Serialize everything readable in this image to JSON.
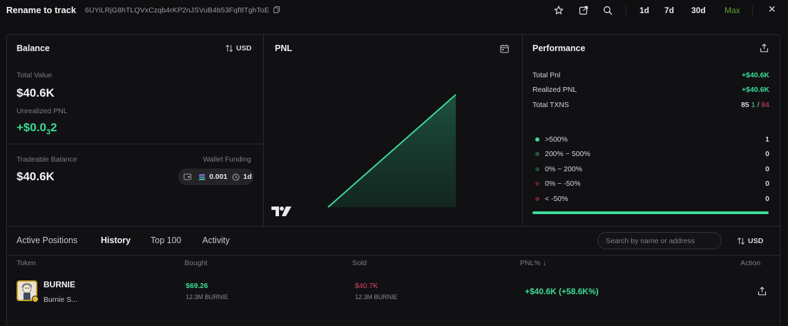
{
  "header": {
    "title": "Rename to track",
    "address": "6UYiLRjG8hTLQVxCzqb4rKP2nJSVuB4b53Fqf8TghToE",
    "timeframes": [
      "1d",
      "7d",
      "30d",
      "Max"
    ]
  },
  "balance": {
    "title": "Balance",
    "currency": "USD",
    "total_value_label": "Total Value",
    "total_value": "$40.6K",
    "unrealized_label": "Unrealized PNL",
    "unrealized_value": "+$0.0",
    "unrealized_subscript": "3",
    "unrealized_tail": "2",
    "tradeable_label": "Tradeable Balance",
    "tradeable_value": "$40.6K",
    "wallet_funding_label": "Wallet Funding",
    "wallet_funding_amount": "0.001",
    "wallet_funding_age": "1d"
  },
  "pnl": {
    "title": "PNL"
  },
  "chart_data": {
    "type": "area",
    "x": [
      0,
      1
    ],
    "values": [
      0,
      40600
    ],
    "title": "PNL",
    "xlabel": "",
    "ylabel": "",
    "grid": false
  },
  "performance": {
    "title": "Performance",
    "total_pnl_label": "Total Pnl",
    "total_pnl": "+$40.6K",
    "realized_label": "Realized PNL",
    "realized": "+$40.6K",
    "txns_label": "Total TXNS",
    "txns_total": "85",
    "txns_buys": "1",
    "txns_sep": "/",
    "txns_sells": "84",
    "buckets": [
      {
        "label": ">500%",
        "count": "1",
        "color": "#3ddc97"
      },
      {
        "label": "200% ~ 500%",
        "count": "0",
        "color": "#1f5a3f"
      },
      {
        "label": "0% ~ 200%",
        "count": "0",
        "color": "#1e4a36"
      },
      {
        "label": "0% ~ -50%",
        "count": "0",
        "color": "#5a1f2e"
      },
      {
        "label": "< -50%",
        "count": "0",
        "color": "#6e2033"
      }
    ],
    "bar_fraction": 1.0
  },
  "tabs": {
    "items": [
      "Active Positions",
      "History",
      "Top 100",
      "Activity"
    ],
    "active": "History",
    "search_placeholder": "Search by name or address",
    "currency": "USD"
  },
  "table": {
    "headers": [
      "Token",
      "Bought",
      "Sold",
      "PNL%",
      "Action"
    ],
    "rows": [
      {
        "name": "BURNIE",
        "subname": "Burnie S...",
        "bought": "$69.26",
        "bought_amount": "12.3M BURNIE",
        "sold": "$40.7K",
        "sold_amount": "12.3M BURNIE",
        "pnl": "+$40.6K (+58.6K%)"
      }
    ]
  },
  "colors": {
    "accent_green": "#3ddc97",
    "accent_red": "#e2456a",
    "max_green": "#5aa33a"
  }
}
